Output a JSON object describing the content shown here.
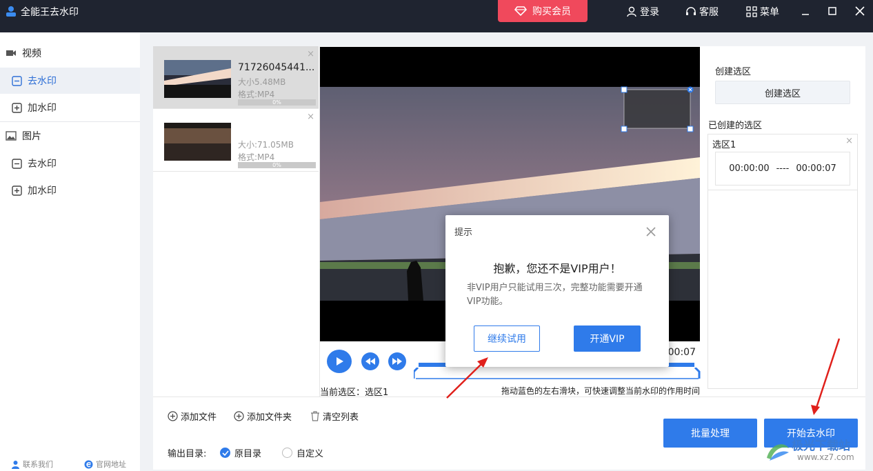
{
  "app": {
    "title": "全能王去水印",
    "buy_label": "购买会员",
    "login_label": "登录",
    "service_label": "客服",
    "menu_label": "菜单"
  },
  "sidebar": {
    "video_label": "视频",
    "video_remove": "去水印",
    "video_add": "加水印",
    "image_label": "图片",
    "image_remove": "去水印",
    "image_add": "加水印",
    "contact_label": "联系我们",
    "website_label": "官网地址"
  },
  "files": [
    {
      "name": "71726045441...",
      "size": "大小5.48MB",
      "format": "格式:MP4",
      "progress": "0%"
    },
    {
      "name": "",
      "size": "大小:71.05MB",
      "format": "格式:MP4",
      "progress": "0%"
    }
  ],
  "player": {
    "time_display": "0:00:07",
    "current_selection": "当前选区：选区1",
    "hint": "拖动蓝色的左右滑块，可快速调整当前水印的作用时间"
  },
  "right_panel": {
    "create_label": "创建选区",
    "create_button": "创建选区",
    "created_label": "已创建的选区",
    "region_name": "选区1",
    "region_start": "00:00:00",
    "region_sep": "----",
    "region_end": "00:00:07"
  },
  "bottom": {
    "add_file": "添加文件",
    "add_folder": "添加文件夹",
    "clear_list": "清空列表",
    "output_label": "输出目录:",
    "option_original": "原目录",
    "option_custom": "自定义",
    "batch_button": "批量处理",
    "start_button": "开始去水印"
  },
  "modal": {
    "title": "提示",
    "heading": "抱歉，您还不是VIP用户！",
    "body": "非VIP用户只能试用三次，完整功能需要开通VIP功能。",
    "continue_button": "继续试用",
    "vip_button": "开通VIP"
  },
  "watermark": {
    "text": "极光下载站",
    "url": "www.xz7.com"
  },
  "colors": {
    "accent": "#2f7bea",
    "buy": "#f0495c",
    "titlebar": "#1f2430"
  }
}
